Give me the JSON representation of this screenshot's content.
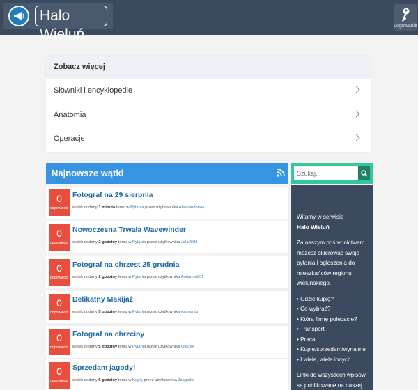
{
  "header": {
    "logo_text": "Halo Wieluń",
    "login_label": "Logowanie"
  },
  "more": {
    "title": "Zobacz więcej",
    "items": [
      "Słowniki i encyklopedie",
      "Anatomia",
      "Operacje"
    ]
  },
  "threads": {
    "title": "Najnowsze wątki",
    "items": [
      {
        "count": "0",
        "label": "odpowiedzi",
        "title": "Fotograf na 29 sierpnia",
        "added": "wątek dodany ",
        "time": "1 minuta",
        "ago": " temu w ",
        "forum": "Pytania",
        "by": " przez użytkownika ",
        "user": "Aleksandrwaa"
      },
      {
        "count": "0",
        "label": "odpowiedzi",
        "title": "Nowoczesna Trwała Wavewinder",
        "added": "wątek dodany ",
        "time": "2 godziny",
        "ago": " temu w ",
        "forum": "Pytania",
        "by": " przez użytkownika ",
        "user": "Jola0609"
      },
      {
        "count": "0",
        "label": "odpowiedzi",
        "title": "Fotograf na chrzest 25 grudnia",
        "added": "wątek dodany ",
        "time": "2 godziny",
        "ago": " temu w ",
        "forum": "Pytania",
        "by": " przez użytkownika ",
        "user": "Adrianna001"
      },
      {
        "count": "0",
        "label": "odpowiedzi",
        "title": "Delikatny Makijaż",
        "added": "wątek dodany ",
        "time": "5 godziny",
        "ago": " temu w ",
        "forum": "Pytania",
        "by": " przez użytkownika ",
        "user": "esandrag"
      },
      {
        "count": "0",
        "label": "odpowiedzi",
        "title": "Fotograf na chrzciny",
        "added": "wątek dodany ",
        "time": "5 godziny",
        "ago": " temu w ",
        "forum": "Pytania",
        "by": " przez użytkownika ",
        "user": "Oliszek"
      },
      {
        "count": "0",
        "label": "odpowiedzi",
        "title": "Sprzedam jagody!",
        "added": "wątek dodany ",
        "time": "6 godziny",
        "ago": " temu w ",
        "forum": "Kupię",
        "by": " przez użytkownika ",
        "user": "Joagoda"
      }
    ]
  },
  "search": {
    "placeholder": "Szukaj..."
  },
  "sidebar": {
    "welcome": "Witamy w serwisie",
    "site_name": "Halo Wieluń",
    "intro": "Za naszym pośrednictwem możesz skierować swoje pytania i ogłoszenia do mieszkańców regionu wieluńskiego.",
    "list": [
      "• Gdzie kupię?",
      "• Co wybrać?",
      "• Którą firmę polecacie?",
      "• Transport",
      "• Praca",
      "• Kupię/sprzedam/wynajmę",
      "• I wiele, wiele innych..."
    ],
    "footer": "Linki do wszystkich wpisów są publikowane na naszej"
  },
  "colors": {
    "topbar": "#3b4a5e",
    "accent_blue": "#3794e2",
    "badge_red": "#e84e3d",
    "search_green": "#34c79e"
  }
}
